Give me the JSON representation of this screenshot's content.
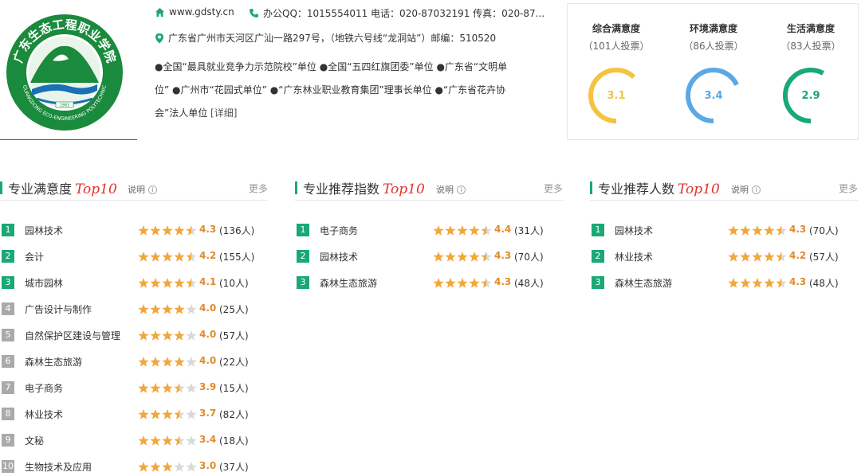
{
  "logo": {
    "top_arc_text": "广东生态工程职业学院",
    "bottom_arc_text": "GUANGDONG ECO-ENGINEERING POLYTECHNIC",
    "year": "1983"
  },
  "contact": {
    "website": "www.gdsty.cn",
    "phone_line": "办公QQ：1015554011 电话：020-87032191 传真：020-87...",
    "address": "广东省广州市天河区广汕一路297号，（地铁六号线“龙洞站”）邮编：510520",
    "honors_line1": "●全国“最具就业竞争力示范院校”单位 ●全国“五四红旗团委”单位 ●广东省“文明单",
    "honors_line2": "位” ●广州市“花园式单位” ●“广东林业职业教育集团”理事长单位 ●“广东省花卉协",
    "honors_line3": "会”法人单位 ",
    "honors_more": "[详细]"
  },
  "satisfaction": [
    {
      "title": "综合满意度",
      "votes": "（101人投票）",
      "value": "3.1",
      "fraction": 0.62,
      "color": "#f5c342"
    },
    {
      "title": "环境满意度",
      "votes": "（86人投票）",
      "value": "3.4",
      "fraction": 0.68,
      "color": "#5aa9e6"
    },
    {
      "title": "生活满意度",
      "votes": "（83人投票）",
      "value": "2.9",
      "fraction": 0.58,
      "color": "#19a974"
    }
  ],
  "panels": [
    {
      "title": "专业满意度",
      "top_label": "Top10",
      "explain_label": "说明",
      "more_label": "更多",
      "items": [
        {
          "rank": "1",
          "name": "园林技术",
          "stars": 4.5,
          "score": "4.3",
          "count": "(136人)"
        },
        {
          "rank": "2",
          "name": "会计",
          "stars": 4.5,
          "score": "4.2",
          "count": "(155人)"
        },
        {
          "rank": "3",
          "name": "城市园林",
          "stars": 4.5,
          "score": "4.1",
          "count": "(10人)"
        },
        {
          "rank": "4",
          "name": "广告设计与制作",
          "stars": 4,
          "score": "4.0",
          "count": "(25人)"
        },
        {
          "rank": "5",
          "name": "自然保护区建设与管理",
          "stars": 4,
          "score": "4.0",
          "count": "(57人)"
        },
        {
          "rank": "6",
          "name": "森林生态旅游",
          "stars": 4,
          "score": "4.0",
          "count": "(22人)"
        },
        {
          "rank": "7",
          "name": "电子商务",
          "stars": 3.5,
          "score": "3.9",
          "count": "(15人)"
        },
        {
          "rank": "8",
          "name": "林业技术",
          "stars": 3.5,
          "score": "3.7",
          "count": "(82人)"
        },
        {
          "rank": "9",
          "name": "文秘",
          "stars": 3.5,
          "score": "3.4",
          "count": "(18人)"
        },
        {
          "rank": "10",
          "name": "生物技术及应用",
          "stars": 3,
          "score": "3.0",
          "count": "(37人)"
        }
      ]
    },
    {
      "title": "专业推荐指数",
      "top_label": "Top10",
      "explain_label": "说明",
      "more_label": "更多",
      "items": [
        {
          "rank": "1",
          "name": "电子商务",
          "stars": 4.5,
          "score": "4.4",
          "count": "(31人)"
        },
        {
          "rank": "2",
          "name": "园林技术",
          "stars": 4.5,
          "score": "4.3",
          "count": "(70人)"
        },
        {
          "rank": "3",
          "name": "森林生态旅游",
          "stars": 4.5,
          "score": "4.3",
          "count": "(48人)"
        }
      ]
    },
    {
      "title": "专业推荐人数",
      "top_label": "Top10",
      "explain_label": "说明",
      "more_label": "更多",
      "items": [
        {
          "rank": "1",
          "name": "园林技术",
          "stars": 4.5,
          "score": "4.3",
          "count": "(70人)"
        },
        {
          "rank": "2",
          "name": "林业技术",
          "stars": 4.5,
          "score": "4.2",
          "count": "(57人)"
        },
        {
          "rank": "3",
          "name": "森林生态旅游",
          "stars": 4.5,
          "score": "4.3",
          "count": "(48人)"
        }
      ]
    }
  ]
}
